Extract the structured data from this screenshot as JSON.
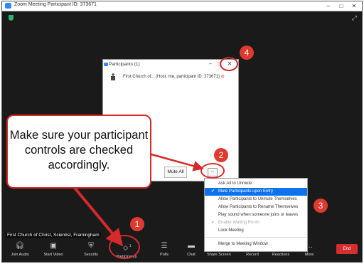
{
  "window": {
    "title": "Zoom Meeting Participant ID: 373671",
    "controls": [
      "–",
      "□",
      "✕"
    ]
  },
  "participants_panel": {
    "title": "Participants (1)",
    "controls": [
      "–",
      "□",
      "✕"
    ],
    "rows": [
      {
        "name": "First Church of... (Host, me, participant ID: 373671)"
      }
    ],
    "mute_all_label": "Mute All",
    "more_label": "..."
  },
  "more_menu": {
    "items": [
      {
        "label": "Ask All to Unmute",
        "checked": false,
        "state": "normal"
      },
      {
        "label": "Mute Participants upon Entry",
        "checked": true,
        "state": "selected"
      },
      {
        "label": "Allow Participants to Unmute Themselves",
        "checked": false,
        "state": "normal"
      },
      {
        "label": "Allow Participants to Rename Themselves",
        "checked": false,
        "state": "normal"
      },
      {
        "label": "Play sound when someone joins or leaves",
        "checked": false,
        "state": "normal"
      },
      {
        "label": "Enable Waiting Room",
        "checked": true,
        "state": "disabled"
      },
      {
        "label": "Lock Meeting",
        "checked": false,
        "state": "normal"
      },
      {
        "label": "Merge to Meeting Window",
        "checked": false,
        "state": "normal"
      }
    ]
  },
  "video": {
    "participant_name": "First Church of Christ, Scientist, Framingham"
  },
  "toolbar": {
    "join_audio": "Join Audio",
    "start_video": "Start Video",
    "security": "Security",
    "participants": "Participants",
    "participants_count": "1",
    "polls": "Polls",
    "chat": "Chat",
    "share_screen": "Share Screen",
    "record": "Record",
    "reactions": "Reactions",
    "more": "More",
    "end": "End"
  },
  "annotation": {
    "callout_text": "Make sure your participant controls are checked accordingly.",
    "badges": [
      "1",
      "2",
      "3",
      "4"
    ]
  },
  "colors": {
    "accent": "#0e72ed",
    "annotation_red": "#d42a2a",
    "end_red": "#d62e2e"
  }
}
